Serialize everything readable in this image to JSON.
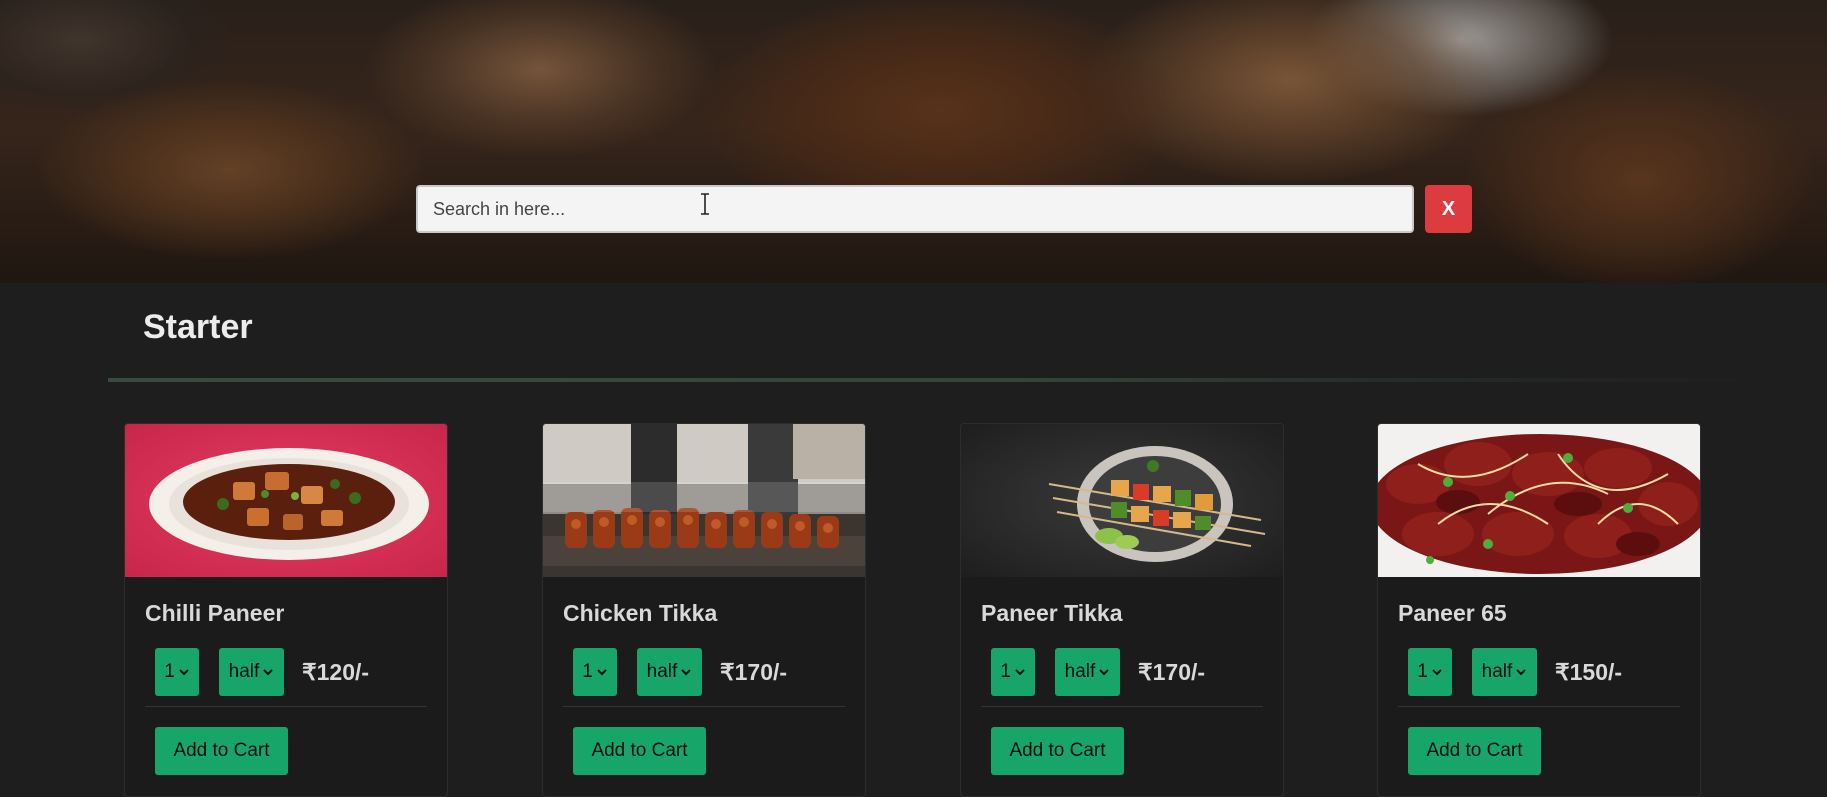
{
  "search": {
    "placeholder": "Search in here...",
    "value": "",
    "clear_label": "X"
  },
  "section": {
    "title": "Starter"
  },
  "colors": {
    "accent": "#17a56a",
    "danger": "#dc3b40",
    "background": "#1e1e1e"
  },
  "items": [
    {
      "name": "Chilli Paneer",
      "quantity": "1",
      "portion": "half",
      "price": "₹120/-",
      "add_label": "Add to Cart"
    },
    {
      "name": "Chicken Tikka",
      "quantity": "1",
      "portion": "half",
      "price": "₹170/-",
      "add_label": "Add to Cart"
    },
    {
      "name": "Paneer Tikka",
      "quantity": "1",
      "portion": "half",
      "price": "₹170/-",
      "add_label": "Add to Cart"
    },
    {
      "name": "Paneer 65",
      "quantity": "1",
      "portion": "half",
      "price": "₹150/-",
      "add_label": "Add to Cart"
    }
  ]
}
